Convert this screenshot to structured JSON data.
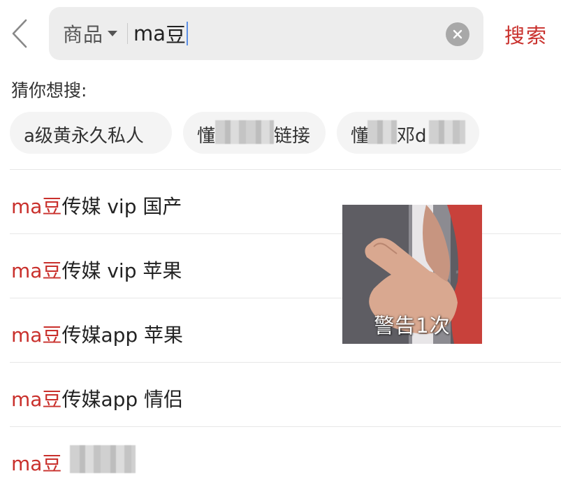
{
  "header": {
    "scope_label": "商品",
    "query_prefix": "ma",
    "query_suffix": "豆",
    "search_label": "搜索",
    "icons": {
      "back": "chevron-left-icon",
      "clear": "clear-x-icon",
      "dropdown": "caret-down-icon"
    }
  },
  "guess": {
    "title": "猜你想搜:",
    "chips": [
      {
        "visible_text": "a级黄永久私人"
      },
      {
        "visible_text_start": "懂",
        "visible_text_end": "链接"
      },
      {
        "visible_text_start": "懂",
        "visible_text_mid": "邓d",
        "visible_text_end": ""
      }
    ]
  },
  "suggestions": [
    {
      "highlight": "ma豆",
      "rest": "传媒 vip 国产"
    },
    {
      "highlight": "ma豆",
      "rest": "传媒 vip 苹果"
    },
    {
      "highlight": "ma豆",
      "rest": "传媒app 苹果"
    },
    {
      "highlight": "ma豆",
      "rest": "传媒app 情侣"
    },
    {
      "highlight": "ma豆",
      "rest": ""
    }
  ],
  "overlay": {
    "caption": "警告1次"
  },
  "colors": {
    "accent": "#c9302c",
    "searchbox_bg": "#ededed",
    "chip_bg": "#f4f4f4",
    "caret": "#5b8fe6"
  }
}
